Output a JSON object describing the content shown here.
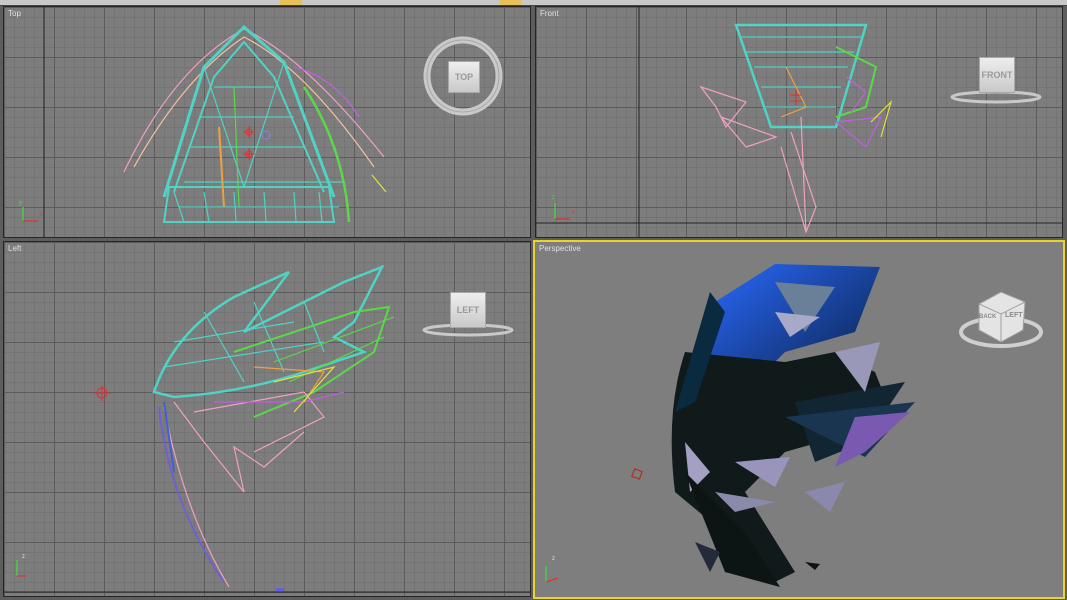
{
  "viewports": {
    "top": {
      "label": "Top",
      "cube_label": "TOP"
    },
    "front": {
      "label": "Front",
      "cube_label": "FRONT"
    },
    "left": {
      "label": "Left",
      "cube_label": "LEFT"
    },
    "perspective": {
      "label": "Perspective",
      "cube_left": "LEFT",
      "cube_back": "BACK"
    }
  },
  "axes": {
    "x": "x",
    "y": "y",
    "z": "z"
  },
  "colors": {
    "active_border": "#e7d52a",
    "wire_teal": "#4fd3c4",
    "wire_green": "#5ad84a",
    "wire_pink": "#f0a0c0",
    "wire_purple": "#c060e0",
    "wire_orange": "#f0a040",
    "gizmo_red": "#e03030"
  },
  "icons": [
    "navcube-icon",
    "axis-tripod-icon",
    "gizmo-icon"
  ]
}
